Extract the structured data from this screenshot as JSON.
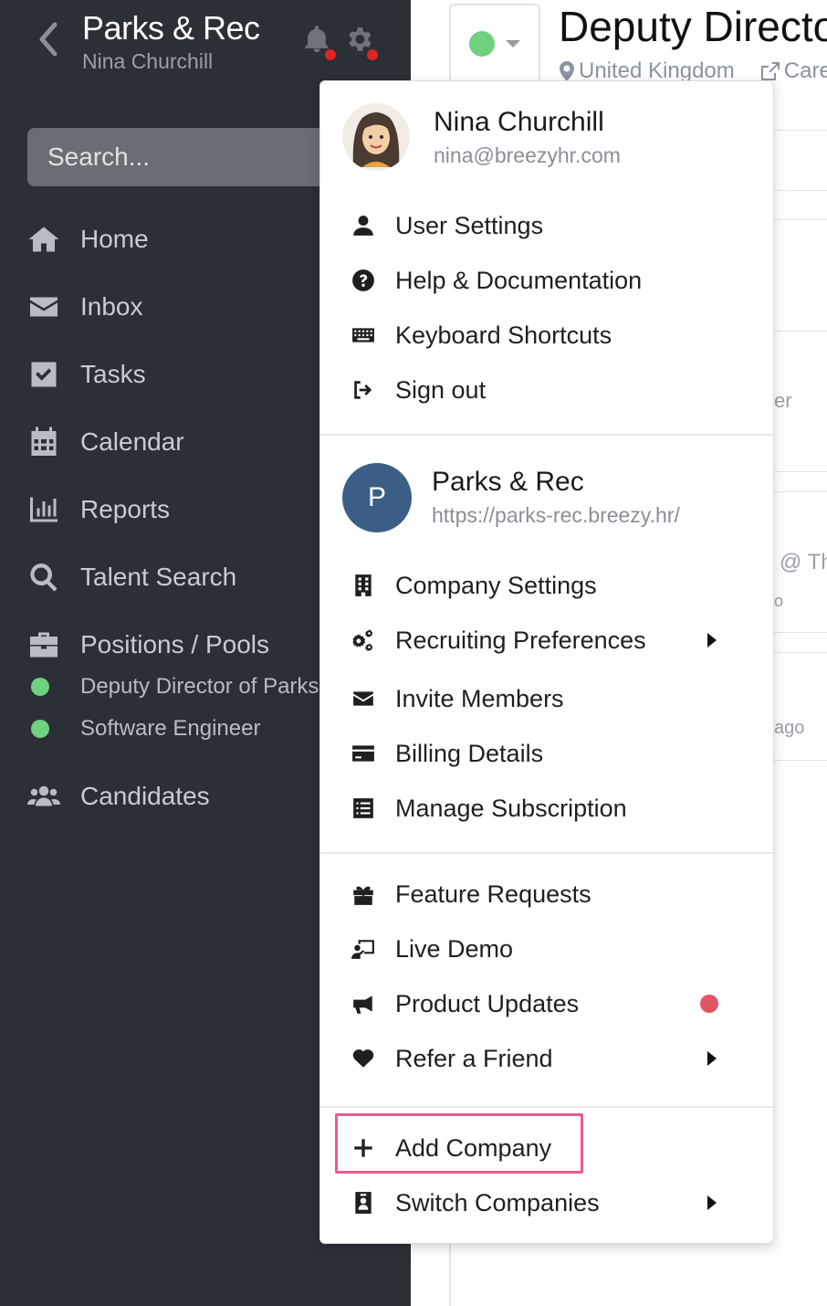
{
  "sidebar": {
    "company_name": "Parks & Rec",
    "user_name": "Nina Churchill",
    "search_placeholder": "Search...",
    "nav": [
      {
        "label": "Home",
        "icon": "home-icon"
      },
      {
        "label": "Inbox",
        "icon": "envelope-icon"
      },
      {
        "label": "Tasks",
        "icon": "checkbox-icon"
      },
      {
        "label": "Calendar",
        "icon": "calendar-icon"
      },
      {
        "label": "Reports",
        "icon": "bar-chart-icon"
      },
      {
        "label": "Talent Search",
        "icon": "search-icon"
      },
      {
        "label": "Positions / Pools",
        "icon": "briefcase-icon"
      }
    ],
    "positions": [
      {
        "label": "Deputy Director of Parks a",
        "status_color": "#6dd17f"
      },
      {
        "label": "Software Engineer",
        "status_color": "#6dd17f"
      }
    ],
    "candidates_label": "Candidates",
    "candidates_icon": "users-icon",
    "notification_dot_color": "#e02424"
  },
  "main": {
    "position_title": "Deputy Directo",
    "location": "United Kingdom",
    "careers_link": "Care",
    "status_color": "#6dd17f",
    "fragments": [
      "er",
      "@ Th",
      "o",
      "ago"
    ]
  },
  "menu": {
    "user": {
      "name": "Nina Churchill",
      "email": "nina@breezyhr.com"
    },
    "user_items": [
      {
        "label": "User Settings",
        "icon": "user-icon"
      },
      {
        "label": "Help & Documentation",
        "icon": "question-circle-icon"
      },
      {
        "label": "Keyboard Shortcuts",
        "icon": "keyboard-icon"
      },
      {
        "label": "Sign out",
        "icon": "sign-out-icon"
      }
    ],
    "company": {
      "initial": "P",
      "name": "Parks & Rec",
      "url": "https://parks-rec.breezy.hr/",
      "badge_color": "#3b5d86"
    },
    "company_items": [
      {
        "label": "Company Settings",
        "icon": "building-icon"
      },
      {
        "label": "Recruiting Preferences",
        "icon": "cogs-icon"
      },
      {
        "label": "Invite Members",
        "icon": "envelope-icon"
      },
      {
        "label": "Billing Details",
        "icon": "credit-card-icon"
      },
      {
        "label": "Manage Subscription",
        "icon": "list-icon"
      }
    ],
    "extra_items": [
      {
        "label": "Feature Requests",
        "icon": "gift-icon"
      },
      {
        "label": "Live Demo",
        "icon": "presentation-icon"
      },
      {
        "label": "Product Updates",
        "icon": "megaphone-icon"
      },
      {
        "label": "Refer a Friend",
        "icon": "heart-icon"
      }
    ],
    "account_items": [
      {
        "label": "Add Company",
        "icon": "plus-icon"
      },
      {
        "label": "Switch Companies",
        "icon": "id-badge-icon"
      }
    ],
    "update_dot_color": "#e25563",
    "highlight_color": "#ea5b8f"
  }
}
